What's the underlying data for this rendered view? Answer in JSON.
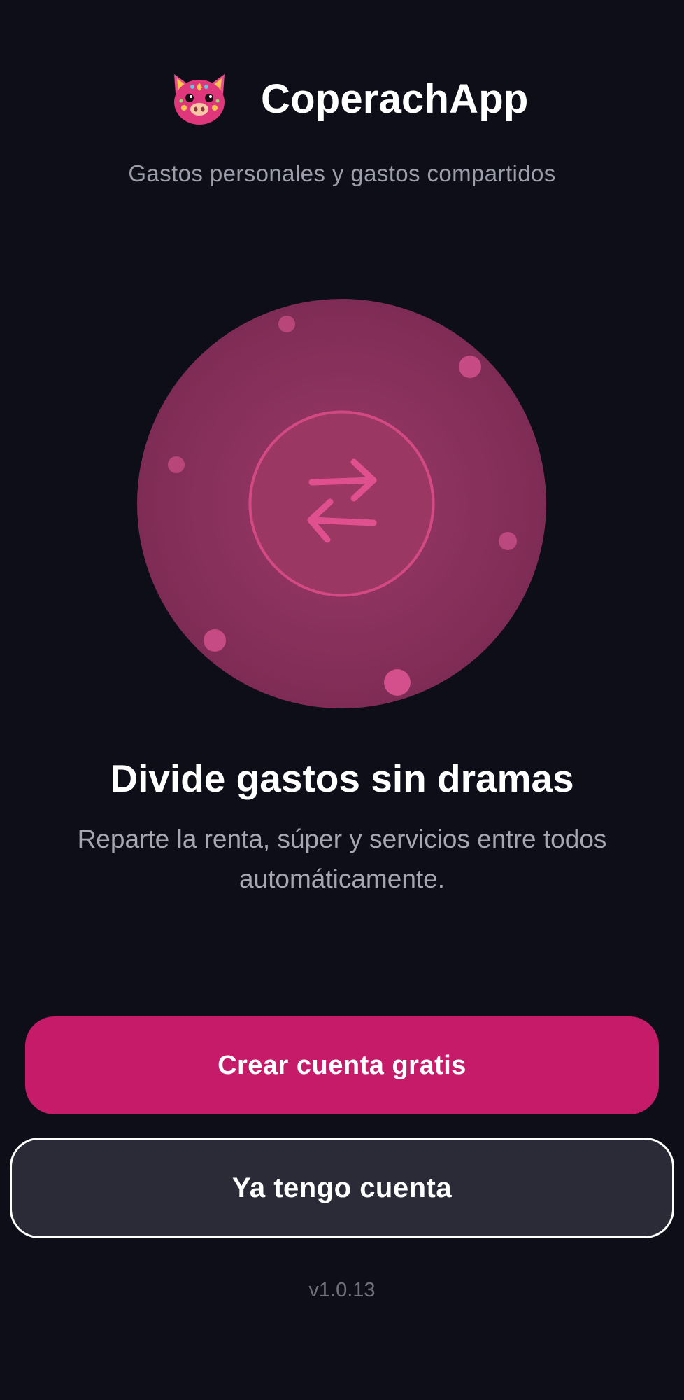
{
  "app": {
    "name": "CoperachApp",
    "tagline": "Gastos personales y gastos compartidos",
    "logo_icon": "pig-mascot-icon"
  },
  "onboarding": {
    "illustration_icon": "swap-arrows-icon",
    "headline": "Divide gastos sin dramas",
    "description": "Reparte la renta, súper y servicios entre todos automáticamente."
  },
  "actions": {
    "create_account_label": "Crear cuenta gratis",
    "login_label": "Ya tengo cuenta"
  },
  "footer": {
    "version": "v1.0.13"
  },
  "colors": {
    "background": "#0d0e17",
    "accent": "#c61b69",
    "circle": "#7e2c55",
    "secondary_button": "#2b2b37"
  }
}
